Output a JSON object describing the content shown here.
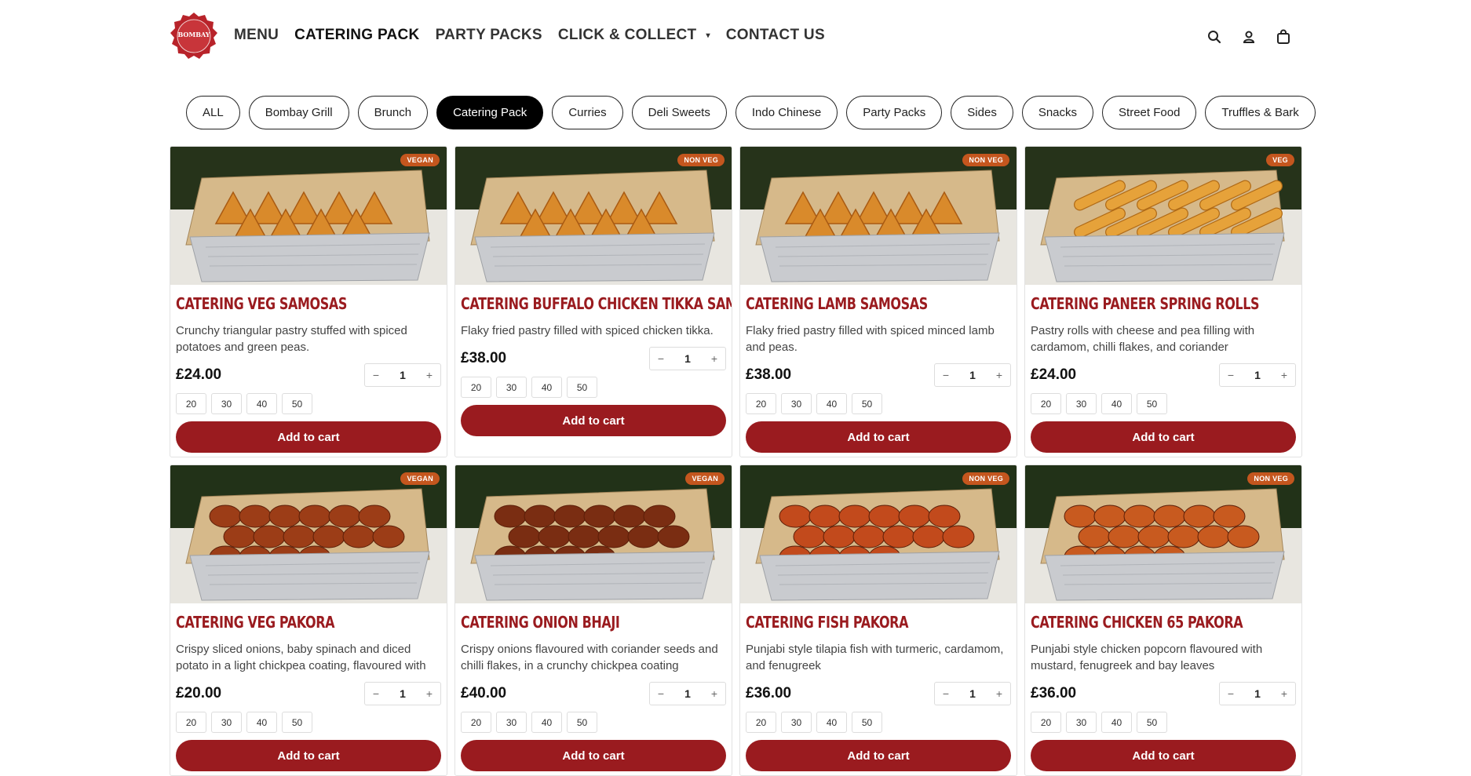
{
  "header": {
    "logo_text": "BOMBAY",
    "nav": [
      {
        "label": "MENU"
      },
      {
        "label": "CATERING PACK"
      },
      {
        "label": "PARTY PACKS"
      },
      {
        "label": "CLICK & COLLECT"
      },
      {
        "label": "CONTACT US"
      }
    ],
    "icons": [
      "search-icon",
      "user-icon",
      "cart-bag-icon"
    ]
  },
  "filters": [
    {
      "label": "ALL"
    },
    {
      "label": "Bombay Grill"
    },
    {
      "label": "Brunch"
    },
    {
      "label": "Catering Pack",
      "active": true
    },
    {
      "label": "Curries"
    },
    {
      "label": "Deli Sweets"
    },
    {
      "label": "Indo Chinese"
    },
    {
      "label": "Party Packs"
    },
    {
      "label": "Sides"
    },
    {
      "label": "Snacks"
    },
    {
      "label": "Street Food"
    },
    {
      "label": "Truffles & Bark"
    }
  ],
  "products": [
    {
      "badge": "VEGAN",
      "title": "CATERING VEG SAMOSAS",
      "desc": "Crunchy triangular pastry stuffed with spiced potatoes and green peas.",
      "price": "£24.00",
      "qty": "1",
      "kind": "samosa"
    },
    {
      "badge": "NON VEG",
      "title": "CATERING BUFFALO CHICKEN TIKKA SAMOSAS",
      "desc": "Flaky fried pastry filled with spiced chicken tikka.",
      "price": "£38.00",
      "qty": "1",
      "kind": "samosa"
    },
    {
      "badge": "NON VEG",
      "title": "CATERING LAMB SAMOSAS",
      "desc": "Flaky fried pastry filled with spiced minced lamb and peas.",
      "price": "£38.00",
      "qty": "1",
      "kind": "samosa"
    },
    {
      "badge": "VEG",
      "title": "CATERING PANEER SPRING ROLLS",
      "desc": "Pastry rolls with cheese and pea filling with cardamom, chilli flakes, and coriander",
      "price": "£24.00",
      "qty": "1",
      "kind": "roll"
    },
    {
      "badge": "VEGAN",
      "title": "CATERING VEG PAKORA",
      "desc": "Crispy sliced onions, baby spinach and diced potato in a light chickpea coating, flavoured with c...",
      "price": "£20.00",
      "qty": "1",
      "kind": "pakora"
    },
    {
      "badge": "VEGAN",
      "title": "CATERING ONION BHAJI",
      "desc": "Crispy onions flavoured with coriander seeds and chilli flakes, in a crunchy chickpea coating",
      "price": "£40.00",
      "qty": "1",
      "kind": "bhaji"
    },
    {
      "badge": "NON VEG",
      "title": "CATERING FISH PAKORA",
      "desc": "Punjabi style tilapia fish with turmeric, cardamom, and fenugreek",
      "price": "£36.00",
      "qty": "1",
      "kind": "fish"
    },
    {
      "badge": "NON VEG",
      "title": "CATERING CHICKEN 65 PAKORA",
      "desc": "Punjabi style chicken popcorn flavoured with mustard, fenugreek and bay leaves",
      "price": "£36.00",
      "qty": "1",
      "kind": "chicken"
    }
  ],
  "sizes": [
    "20",
    "30",
    "40",
    "50"
  ],
  "stepper": {
    "minus": "−",
    "plus": "+"
  },
  "add_to_cart_label": "Add to cart",
  "colors": {
    "brand": "#9a1b1f",
    "badge": "#c4561e",
    "active_chip": "#000000"
  }
}
